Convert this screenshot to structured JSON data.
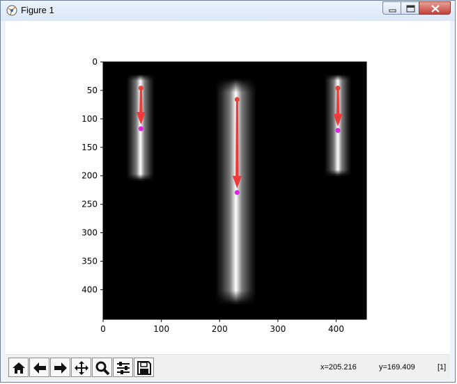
{
  "window": {
    "title": "Figure 1"
  },
  "toolbar": {
    "buttons": [
      "home-icon",
      "back-icon",
      "forward-icon",
      "pan-icon",
      "zoom-icon",
      "subplots-icon",
      "save-icon"
    ]
  },
  "status": {
    "x_readout": "x=205.216",
    "y_readout": "y=169.409",
    "value_readout": "[1]"
  },
  "colors": {
    "start_point": "#e8433a",
    "end_point": "#e024e0",
    "arrow": "#f03a3a",
    "background": "#000000"
  },
  "chart_data": {
    "type": "image",
    "xlim": [
      0,
      452
    ],
    "ylim": [
      452,
      0
    ],
    "xticks": [
      0,
      100,
      200,
      300,
      400
    ],
    "yticks": [
      0,
      50,
      100,
      150,
      200,
      250,
      300,
      350,
      400
    ],
    "bars": [
      {
        "x0": 40,
        "x1": 88,
        "y0": 22,
        "y1": 208
      },
      {
        "x0": 193,
        "x1": 263,
        "y0": 30,
        "y1": 425
      },
      {
        "x0": 380,
        "x1": 426,
        "y0": 22,
        "y1": 200
      }
    ],
    "arrows": [
      {
        "start": [
          65,
          46
        ],
        "end": [
          65,
          110
        ]
      },
      {
        "start": [
          230,
          66
        ],
        "end": [
          230,
          222
        ]
      },
      {
        "start": [
          403,
          46
        ],
        "end": [
          403,
          113
        ]
      }
    ]
  }
}
